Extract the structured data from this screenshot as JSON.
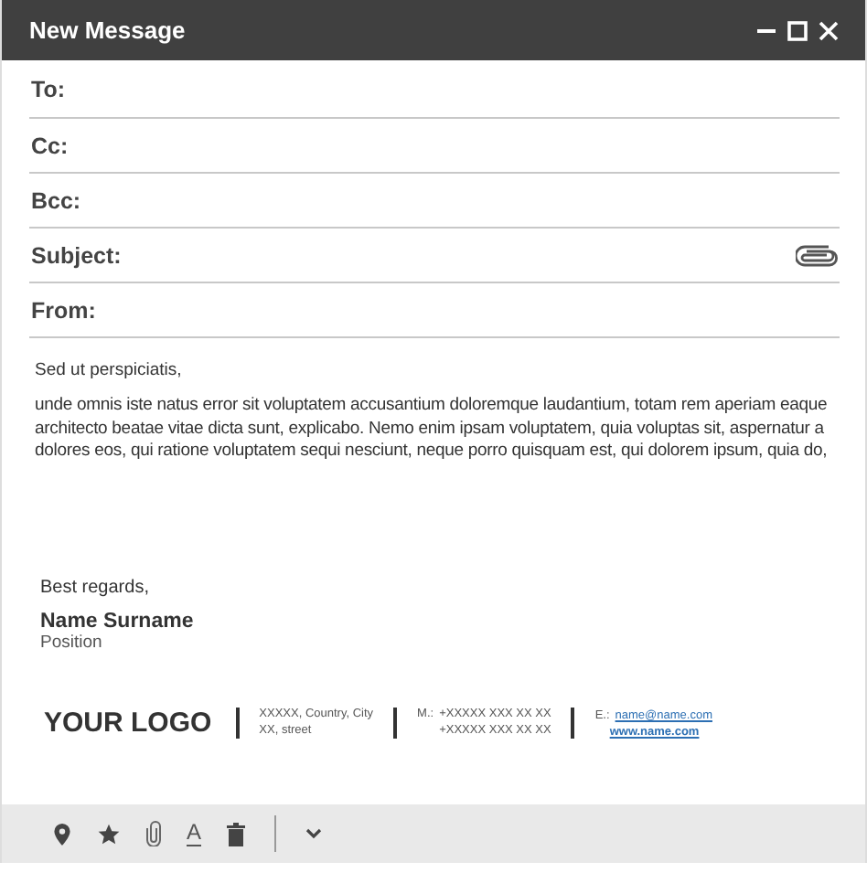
{
  "window": {
    "title": "New Message"
  },
  "fields": [
    {
      "label": "To:",
      "attachment": false
    },
    {
      "label": "Cc:",
      "attachment": false
    },
    {
      "label": "Bcc:",
      "attachment": false
    },
    {
      "label": "Subject:",
      "attachment": true
    },
    {
      "label": "From:",
      "attachment": false
    }
  ],
  "body": {
    "greeting": "Sed ut perspiciatis,",
    "paragraph": "unde omnis iste natus error sit voluptatem accusantium doloremque laudantium, totam rem aperiam eaque architecto beatae vitae dicta sunt, explicabo. Nemo enim ipsam voluptatem, quia voluptas sit, aspernatur a dolores eos, qui ratione voluptatem sequi nesciunt, neque porro quisquam est, qui dolorem ipsum, quia do,",
    "closing": "Best regards,",
    "name": "Name Surname",
    "position": "Position"
  },
  "signature": {
    "logo": "YOUR LOGO",
    "address": [
      "XXXXX, Country, City",
      "XX, street"
    ],
    "phone_label": "M.:",
    "phones": [
      "+XXXXX XXX XX XX",
      "+XXXXX XXX XX XX"
    ],
    "email_label": "E.:",
    "email": "name@name.com",
    "website": "www.name.com"
  },
  "toolbar": [
    {
      "kind": "location"
    },
    {
      "kind": "star"
    },
    {
      "kind": "attach"
    },
    {
      "kind": "format",
      "glyph": "A"
    },
    {
      "kind": "trash"
    },
    {
      "kind": "separator"
    },
    {
      "kind": "more"
    }
  ]
}
